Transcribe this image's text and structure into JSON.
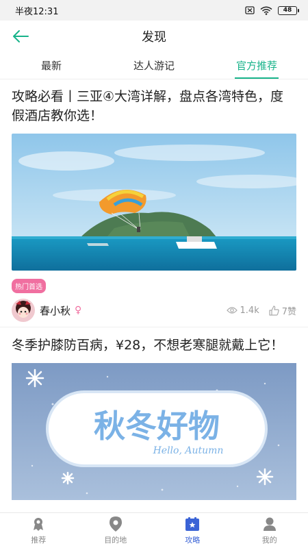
{
  "status_bar": {
    "time": "半夜12:31",
    "battery": "48"
  },
  "header": {
    "title": "发现"
  },
  "tabs": [
    {
      "label": "最新"
    },
    {
      "label": "达人游记"
    },
    {
      "label": "官方推荐"
    }
  ],
  "active_tab_color": "#17b38a",
  "articles": [
    {
      "title": "攻略必看丨三亚④大湾详解，盘点各湾特色，度假酒店教你选！",
      "tag": "热门首选",
      "author": "春小秋",
      "gender_symbol": "♀",
      "views": "1.4k",
      "likes": "7赞"
    },
    {
      "title": "冬季护膝防百病，¥28，不想老寒腿就戴上它！",
      "banner_main": "秋冬好物",
      "banner_sub": "Hello, Autumn"
    }
  ],
  "bottom_nav": [
    {
      "label": "推荐",
      "icon": "recommend-icon"
    },
    {
      "label": "目的地",
      "icon": "location-pin-icon"
    },
    {
      "label": "攻略",
      "icon": "guide-icon"
    },
    {
      "label": "我的",
      "icon": "profile-icon"
    }
  ],
  "colors": {
    "accent_green": "#17b38a",
    "accent_blue": "#3a63d6",
    "tag_pink": "#f06fa0"
  }
}
